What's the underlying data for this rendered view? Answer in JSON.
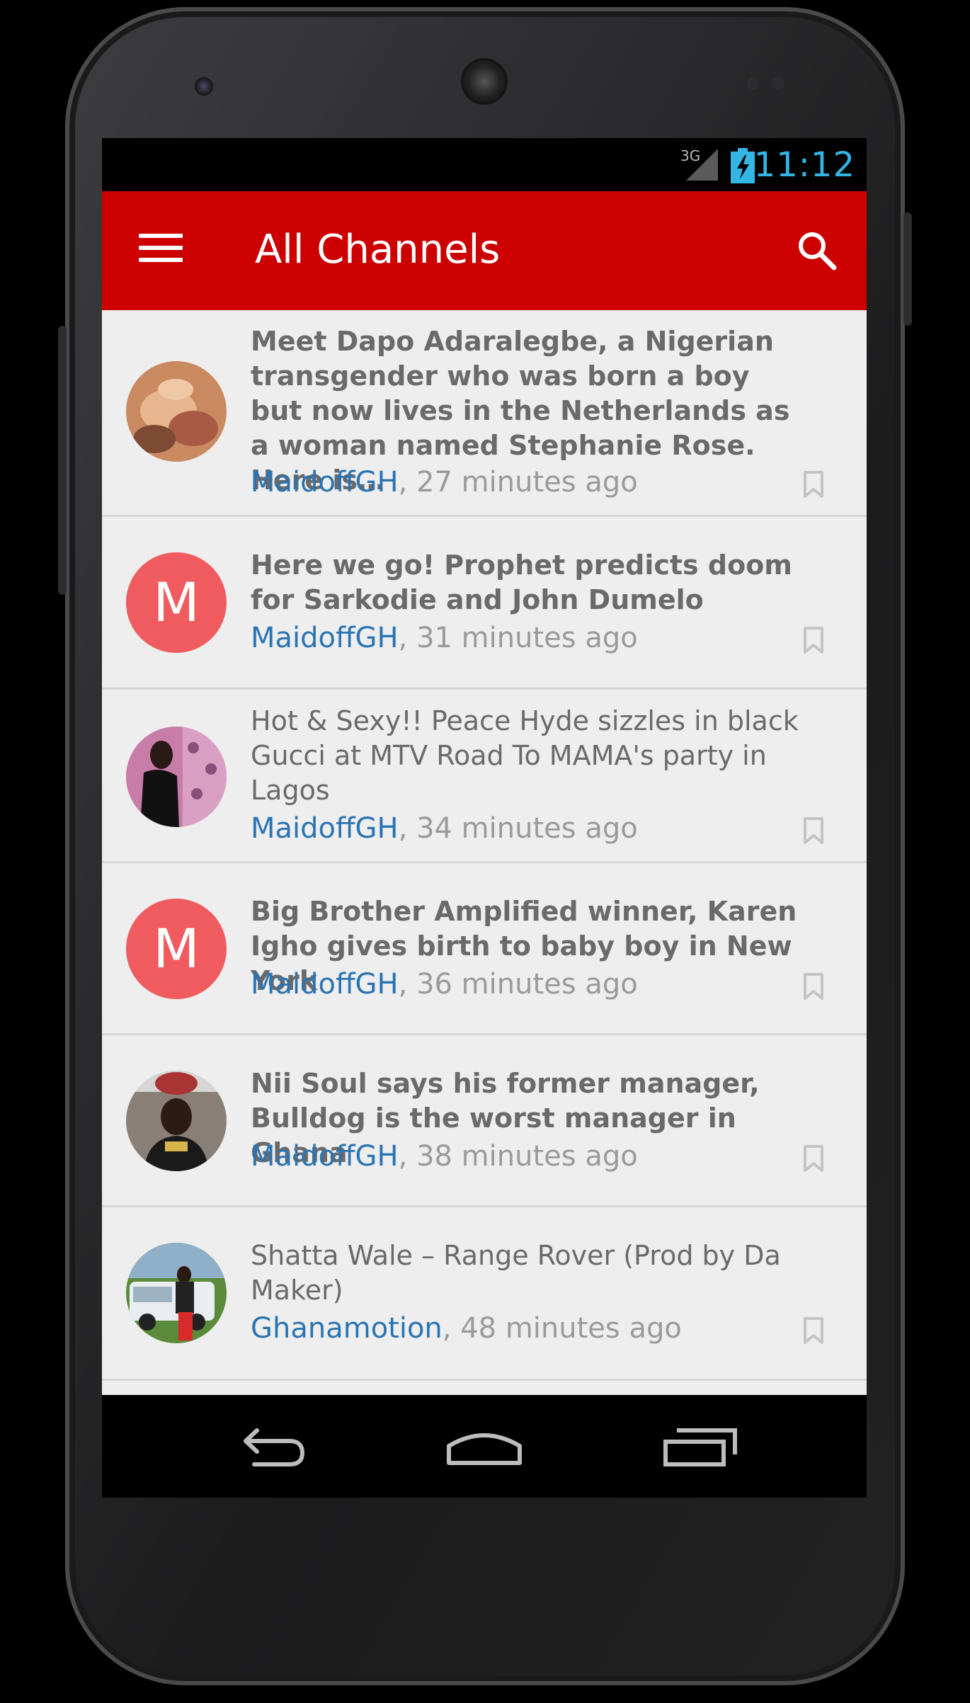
{
  "status_bar": {
    "network": "3G",
    "time": "11:12"
  },
  "app_bar": {
    "title": "All Channels",
    "menu_icon": "hamburger-menu-icon",
    "search_icon": "search-icon"
  },
  "feed": {
    "items": [
      {
        "headline": "Meet Dapo Adaralegbe, a Nigerian transgender who was born a boy but now lives in the Netherlands as a woman named Stephanie Rose. Here  is…",
        "source": "MaidoffGH",
        "time": ", 27 minutes ago",
        "avatar": "photo",
        "bold": true
      },
      {
        "headline": "Here we go! Prophet predicts doom for Sarkodie and John Dumelo",
        "source": "MaidoffGH",
        "time": ", 31 minutes ago",
        "avatar": "letter",
        "letter": "M",
        "bold": true
      },
      {
        "headline": "Hot & Sexy!! Peace Hyde sizzles in black Gucci at MTV Road To MAMA's party in Lagos",
        "source": "MaidoffGH",
        "time": ", 34 minutes ago",
        "avatar": "photo",
        "bold": false
      },
      {
        "headline": "Big Brother Amplified winner, Karen Igho gives birth to baby boy in New York",
        "source": "MaidoffGH",
        "time": ", 36 minutes ago",
        "avatar": "letter",
        "letter": "M",
        "bold": true
      },
      {
        "headline": "Nii Soul says his former manager, Bulldog is the worst manager in Ghana",
        "source": "MaidoffGH",
        "time": ", 38 minutes ago",
        "avatar": "photo",
        "bold": true
      },
      {
        "headline": "Shatta Wale – Range Rover (Prod by Da Maker)",
        "source": "Ghanamotion",
        "time": ", 48 minutes ago",
        "avatar": "photo",
        "bold": false
      }
    ]
  },
  "nav_bar": {
    "back_icon": "back-icon",
    "home_icon": "home-icon",
    "recents_icon": "recent-apps-icon"
  },
  "colors": {
    "app_bar": "#cc0000",
    "source_link": "#2a74b3",
    "letter_avatar": "#f05b5f",
    "clock": "#33b5e5"
  }
}
